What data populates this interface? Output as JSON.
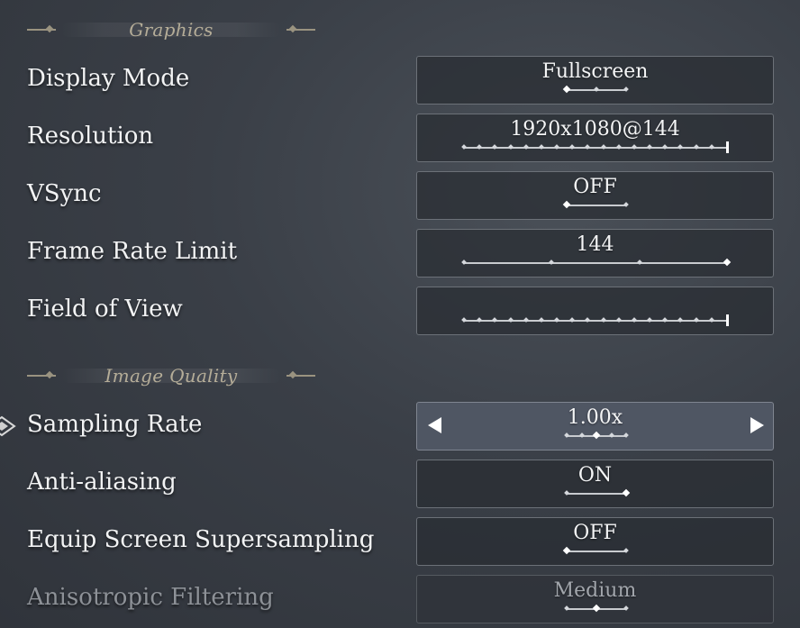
{
  "sections": {
    "graphics": {
      "title": "Graphics"
    },
    "image_quality": {
      "title": "Image Quality"
    }
  },
  "rows": {
    "display_mode": {
      "label": "Display Mode",
      "value": "Fullscreen",
      "options_count": 3,
      "selected_index": 0
    },
    "resolution": {
      "label": "Resolution",
      "value": "1920x1080@144",
      "options_count": 18,
      "selected_index": 17
    },
    "vsync": {
      "label": "VSync",
      "value": "OFF",
      "options_count": 2,
      "selected_index": 0
    },
    "frame_rate_limit": {
      "label": "Frame Rate Limit",
      "value": "144",
      "options_count": 4,
      "selected_index": 3
    },
    "field_of_view": {
      "label": "Field of View",
      "value": "",
      "options_count": 18,
      "selected_index": 17
    },
    "sampling_rate": {
      "label": "Sampling Rate",
      "value": "1.00x",
      "options_count": 5,
      "selected_index": 2
    },
    "anti_aliasing": {
      "label": "Anti-aliasing",
      "value": "ON",
      "options_count": 2,
      "selected_index": 1
    },
    "equip_screen_supersampling": {
      "label": "Equip Screen Supersampling",
      "value": "OFF",
      "options_count": 2,
      "selected_index": 0
    },
    "anisotropic_filtering": {
      "label": "Anisotropic Filtering",
      "value": "Medium",
      "options_count": 3,
      "selected_index": 1
    }
  },
  "icons": {
    "focus_pointer": "diamond-pointer-icon",
    "left_arrow": "left-arrow-icon",
    "right_arrow": "right-arrow-icon"
  },
  "colors": {
    "accent_header": "#b5ad98",
    "label": "#f2f3f4",
    "disabled": "#8d9197",
    "active_row_bg": "#4f5663"
  }
}
